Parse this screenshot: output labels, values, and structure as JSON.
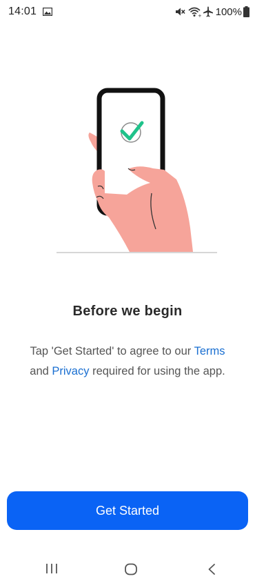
{
  "status_bar": {
    "time": "14:01",
    "battery": "100%",
    "icons": [
      "gallery-icon",
      "mute-icon",
      "wifi-icon",
      "airplane-icon",
      "battery-icon"
    ]
  },
  "content": {
    "title": "Before we begin",
    "desc_prefix": "Tap 'Get Started' to agree to our",
    "terms_link": "Terms",
    "conjunction": "and",
    "privacy_link": "Privacy",
    "desc_suffix": "required for using the app."
  },
  "cta": {
    "label": "Get Started"
  },
  "nav_bar": {
    "icons": [
      "recent-apps-icon",
      "home-icon",
      "back-icon"
    ]
  },
  "colors": {
    "primary": "#0a63f5",
    "link": "#1a6fd1",
    "check": "#1fc28a",
    "hand": "#f6a49a"
  }
}
